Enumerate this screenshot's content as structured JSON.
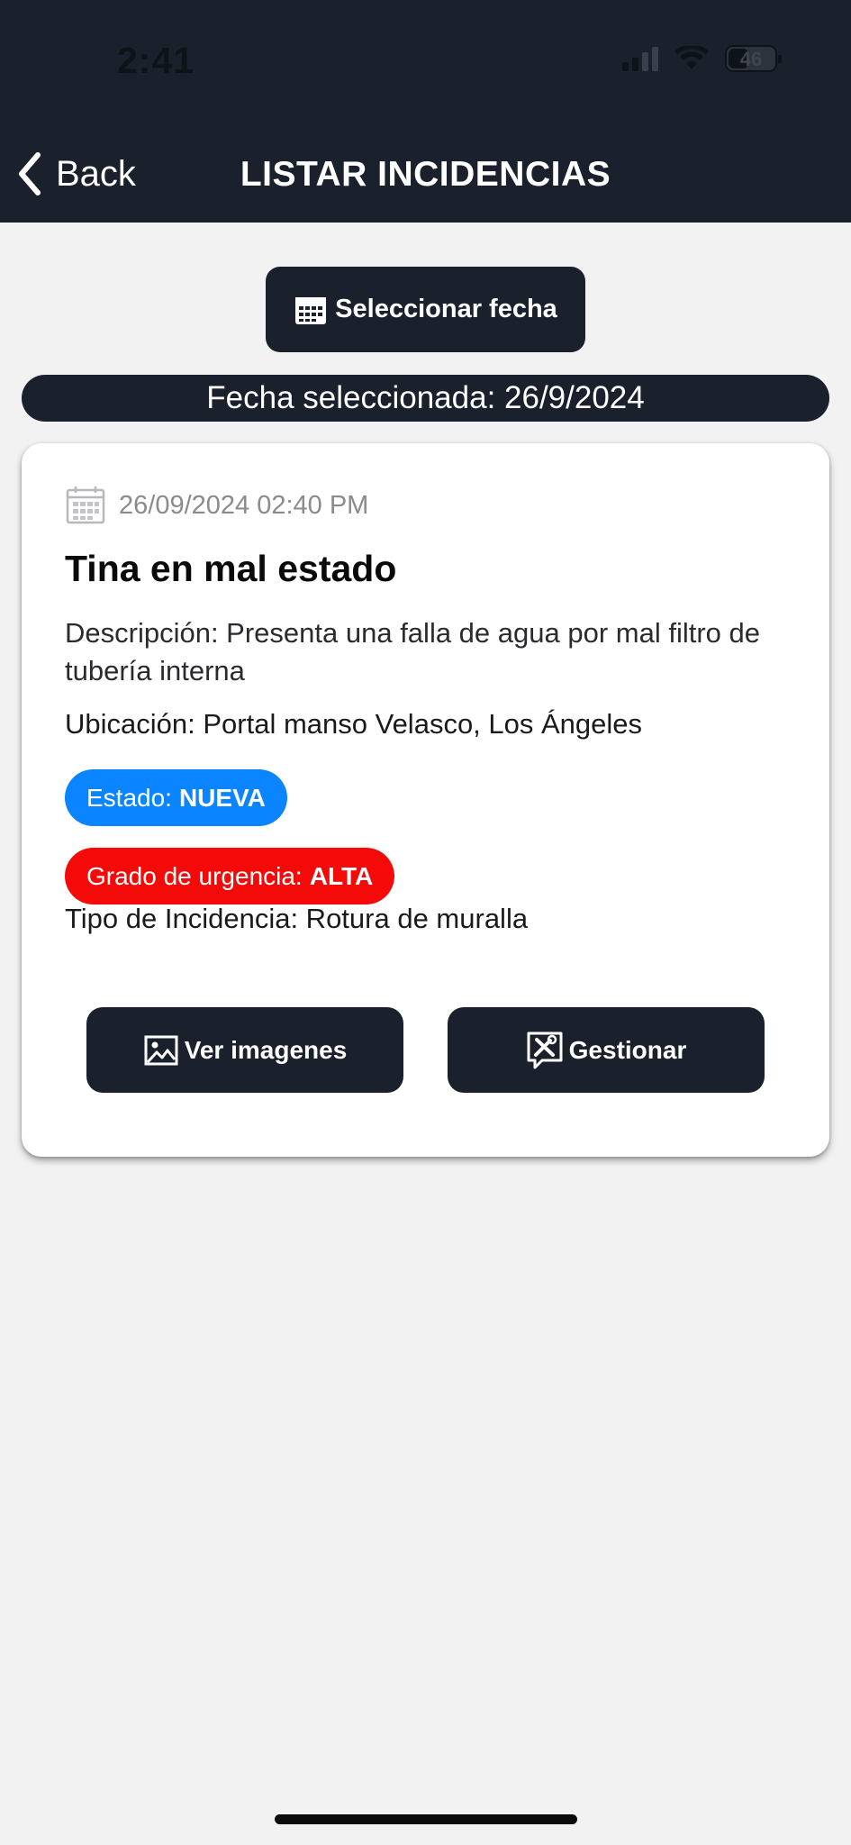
{
  "status_bar": {
    "time": "2:41",
    "battery_text": "46",
    "battery_level": 0.46,
    "signal_bars_active": 2,
    "signal_bars_total": 4
  },
  "nav": {
    "back_label": "Back",
    "title": "LISTAR INCIDENCIAS"
  },
  "date_picker": {
    "button_label": "Seleccionar fecha",
    "selected_text": "Fecha seleccionada: 26/9/2024"
  },
  "incident": {
    "datetime": "26/09/2024 02:40 PM",
    "title": "Tina en mal estado",
    "description": "Descripción: Presenta una falla de agua por mal filtro de tubería interna",
    "location": "Ubicación: Portal manso Velasco, Los Ángeles",
    "state_label": "Estado:",
    "state_value": "NUEVA",
    "urgency_label": "Grado de urgencia:",
    "urgency_value": "ALTA",
    "type": "Tipo de Incidencia: Rotura de muralla",
    "view_images_label": "Ver imagenes",
    "manage_label": "Gestionar"
  },
  "colors": {
    "header_bg": "#1b212c",
    "page_bg": "#f2f2f3",
    "state_badge": "#0a84ff",
    "urgency_badge": "#f50a0a"
  },
  "icons": {
    "back": "chevron-left-icon",
    "date_button": "calendar-icon",
    "date_row": "calendar-icon",
    "view_images": "image-icon",
    "manage": "tools-chat-icon"
  }
}
